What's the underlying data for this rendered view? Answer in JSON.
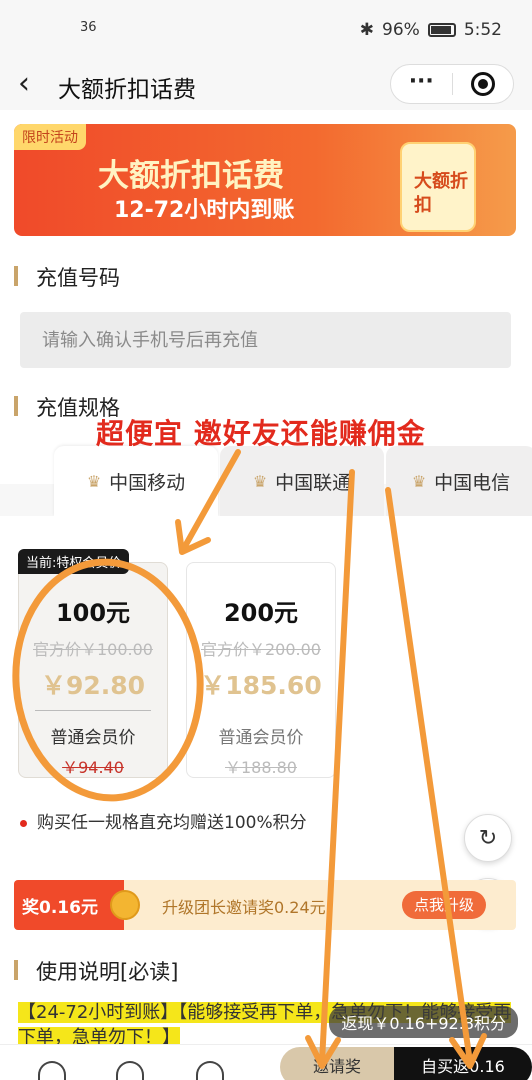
{
  "status": {
    "signal": "36",
    "battery": "96%",
    "time": "5:52"
  },
  "nav": {
    "back": "<",
    "title": "大额折扣话费",
    "more": "···"
  },
  "banner": {
    "tag": "限时活动",
    "line1": "大额折扣话费",
    "line2": "12-72小时内到账",
    "card": "大额折扣"
  },
  "recharge_number": {
    "title": "充值号码",
    "placeholder": "请输入确认手机号后再充值"
  },
  "spec": {
    "title": "充值规格"
  },
  "promo_overlay": "超便宜 邀好友还能赚佣金",
  "tabs": [
    {
      "label": "中国移动"
    },
    {
      "label": "中国联通"
    },
    {
      "label": "中国电信"
    }
  ],
  "plans": [
    {
      "badge": "当前:特权会员价",
      "face": "100元",
      "official": "官方价￥100.00",
      "price": "￥92.80",
      "member_label": "普通会员价",
      "member_price": "￥94.40"
    },
    {
      "face": "200元",
      "official": "官方价￥200.00",
      "price": "￥185.60",
      "member_label": "普通会员价",
      "member_price": "￥188.80"
    }
  ],
  "note": "购买任一规格直充均赠送100%积分",
  "reward": {
    "left": "奖0.16元",
    "mid": "升级团长邀请奖0.24元",
    "button": "点我升级"
  },
  "usage": {
    "title": "使用说明[必读]",
    "text": "【24-72小时到账】【能够接受再下单，急单勿下！能够接受再下单，急单勿下！】"
  },
  "cashback": "返现￥0.16+92.8积分",
  "bottom": {
    "invite": "邀请奖",
    "selfbuy": "自买返0.16"
  }
}
